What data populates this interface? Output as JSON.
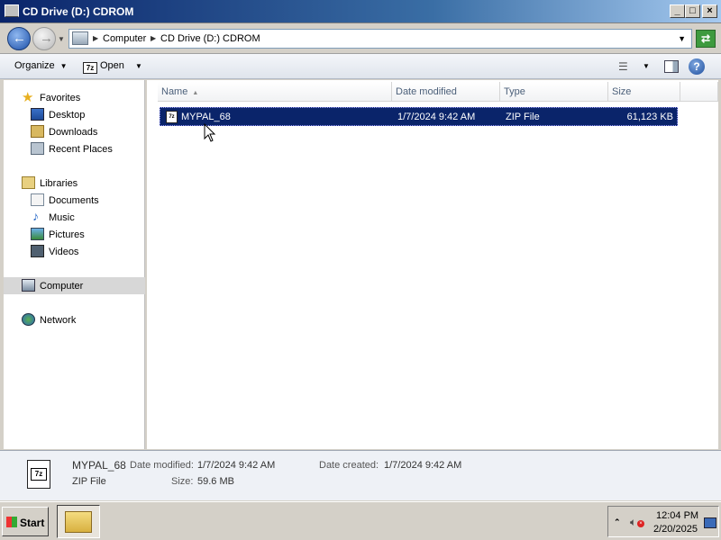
{
  "window": {
    "title": "CD Drive (D:) CDROM",
    "controls": {
      "minimize": "_",
      "maximize": "□",
      "close": "×"
    }
  },
  "address": {
    "crumbs": [
      "Computer",
      "CD Drive (D:) CDROM"
    ],
    "back_glyph": "←",
    "forward_glyph": "→",
    "refresh_glyph": "⇄"
  },
  "toolbar": {
    "organize_label": "Organize",
    "open_label": "Open",
    "open_icon_text": "7z",
    "help_glyph": "?"
  },
  "navpane": {
    "favorites": {
      "label": "Favorites",
      "items": [
        {
          "label": "Desktop"
        },
        {
          "label": "Downloads"
        },
        {
          "label": "Recent Places"
        }
      ]
    },
    "libraries": {
      "label": "Libraries",
      "items": [
        {
          "label": "Documents"
        },
        {
          "label": "Music"
        },
        {
          "label": "Pictures"
        },
        {
          "label": "Videos"
        }
      ]
    },
    "computer_label": "Computer",
    "network_label": "Network"
  },
  "filelist": {
    "columns": [
      "Name",
      "Date modified",
      "Type",
      "Size"
    ],
    "rows": [
      {
        "name": "MYPAL_68",
        "date_modified": "1/7/2024 9:42 AM",
        "type": "ZIP File",
        "size": "61,123 KB",
        "icon_text": "7z"
      }
    ]
  },
  "details": {
    "name": "MYPAL_68",
    "type": "ZIP File",
    "date_modified_label": "Date modified:",
    "date_modified": "1/7/2024 9:42 AM",
    "date_created_label": "Date created:",
    "date_created": "1/7/2024 9:42 AM",
    "size_label": "Size:",
    "size": "59.6 MB",
    "icon_text": "7z"
  },
  "taskbar": {
    "start_label": "Start",
    "time": "12:04 PM",
    "date": "2/20/2025"
  }
}
